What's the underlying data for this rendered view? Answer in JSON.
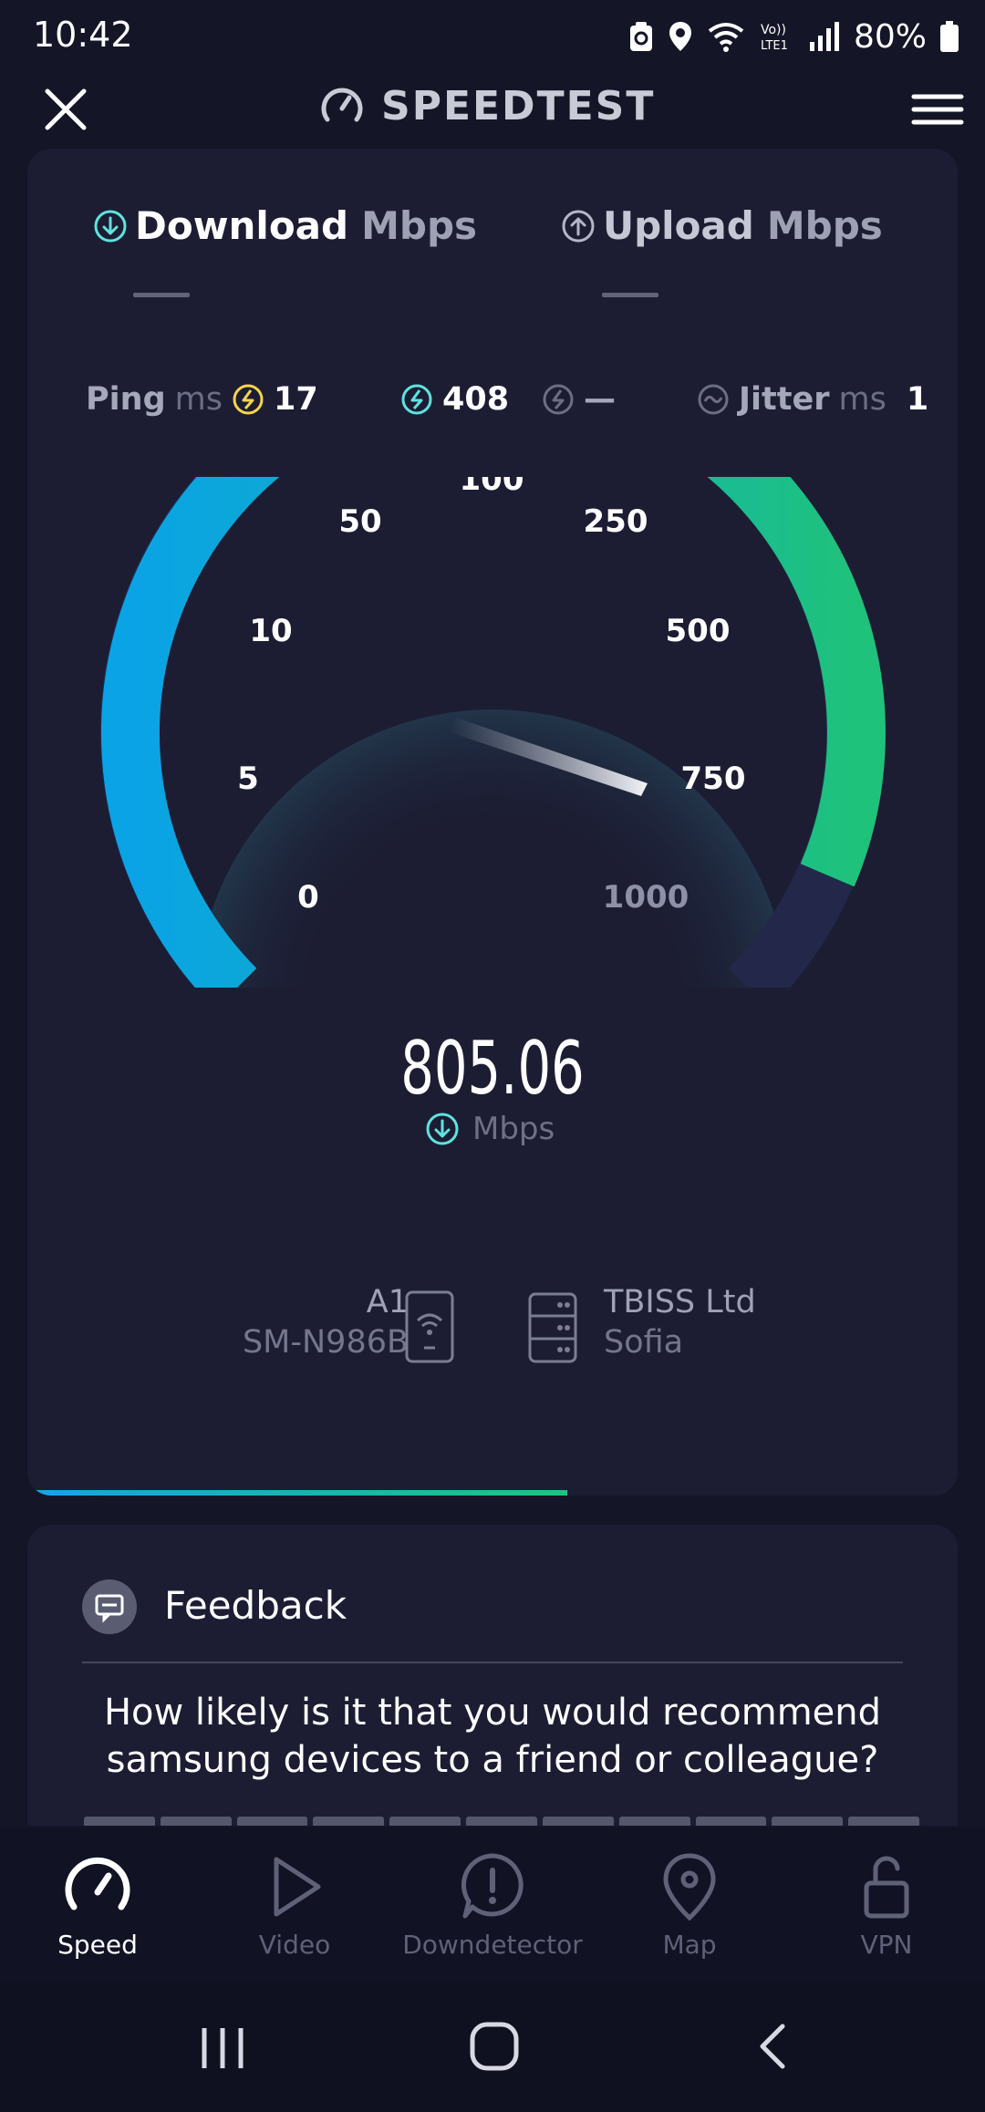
{
  "status_bar": {
    "time": "10:42",
    "battery": "80%"
  },
  "app": {
    "title": "SPEEDTEST"
  },
  "test": {
    "download_label": "Download",
    "download_unit": "Mbps",
    "upload_label": "Upload",
    "upload_unit": "Mbps",
    "ping_label": "Ping",
    "ping_unit": "ms",
    "ping_idle": "17",
    "ping_download": "408",
    "ping_upload": "—",
    "jitter_label": "Jitter",
    "jitter_unit": "ms",
    "jitter_value": "1",
    "gauge_ticks": [
      "0",
      "5",
      "10",
      "50",
      "100",
      "250",
      "500",
      "750",
      "1000"
    ],
    "current_speed": "805.06",
    "current_unit": "Mbps",
    "progress": 0.58
  },
  "device": {
    "provider": "A1",
    "model": "SM-N986B"
  },
  "server": {
    "name": "TBISS Ltd",
    "location": "Sofia"
  },
  "feedback": {
    "title": "Feedback",
    "question": "How likely is it that you would recommend samsung devices to a friend or colleague?"
  },
  "nav": {
    "items": [
      {
        "label": "Speed",
        "icon": "gauge-icon",
        "active": true
      },
      {
        "label": "Video",
        "icon": "play-icon",
        "active": false
      },
      {
        "label": "Downdetector",
        "icon": "alert-bubble-icon",
        "active": false
      },
      {
        "label": "Map",
        "icon": "map-pin-icon",
        "active": false
      },
      {
        "label": "VPN",
        "icon": "unlock-icon",
        "active": false
      }
    ]
  },
  "colors": {
    "gauge_start": "#0aa3e6",
    "gauge_end": "#1fc27a",
    "accent_cyan": "#5fe3df",
    "ping_yellow": "#f5d54a"
  }
}
